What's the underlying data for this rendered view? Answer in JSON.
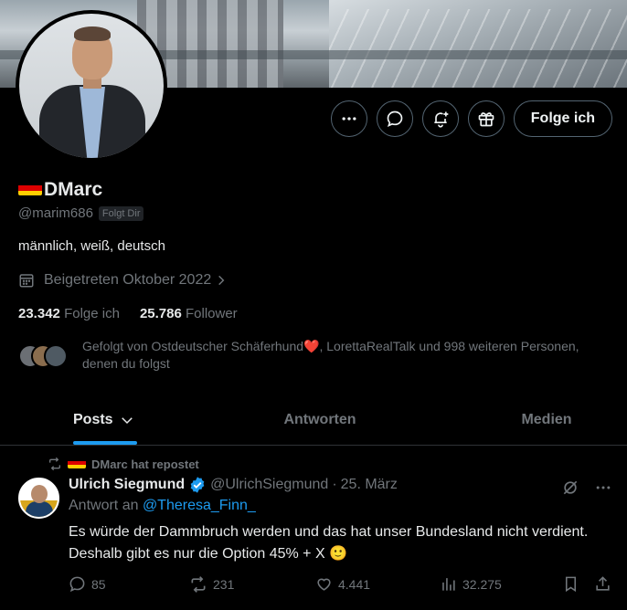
{
  "profile": {
    "display_name": "DMarc",
    "handle": "@marim686",
    "follows_you_badge": "Folgt Dir",
    "bio": "männlich, weiß, deutsch",
    "joined": "Beigetreten Oktober 2022",
    "following_count": "23.342",
    "following_label": "Folge ich",
    "followers_count": "25.786",
    "followers_label": "Follower",
    "followed_by_prefix": "Gefolgt von Ostdeutscher Schäferhund",
    "followed_by_suffix": ", LorettaRealTalk und 998 weiteren Personen, denen du folgst",
    "follow_button_label": "Folge ich"
  },
  "tabs": [
    {
      "label": "Posts"
    },
    {
      "label": "Antworten"
    },
    {
      "label": "Medien"
    }
  ],
  "tweet": {
    "repost_label": "DMarc hat repostet",
    "author_name": "Ulrich Siegmund",
    "author_handle": "@UlrichSiegmund",
    "separator": "·",
    "date": "25. März",
    "reply_prefix": "Antwort an",
    "reply_to": "@Theresa_Finn_",
    "text": "Es würde der Dammbruch werden und das hat unser Bundesland nicht verdient. Deshalb gibt es nur die Option 45% + X 🙂",
    "replies": "85",
    "reposts": "231",
    "likes": "4.441",
    "views": "32.275"
  },
  "colors": {
    "accent": "#1d9bf0",
    "muted_text": "#71767b",
    "border": "#2f3336",
    "like_heart": "#f91880"
  },
  "icons": {
    "more": "more-icon",
    "message": "message-icon",
    "notify": "bell-plus-icon",
    "gift": "gift-icon",
    "calendar": "calendar-icon",
    "chevron": "chevron-right-icon",
    "repost": "repost-icon",
    "verified": "verified-badge-icon",
    "grok": "grok-icon",
    "reply": "reply-icon",
    "like": "heart-icon",
    "views": "views-icon",
    "bookmark": "bookmark-icon",
    "share": "share-icon"
  }
}
